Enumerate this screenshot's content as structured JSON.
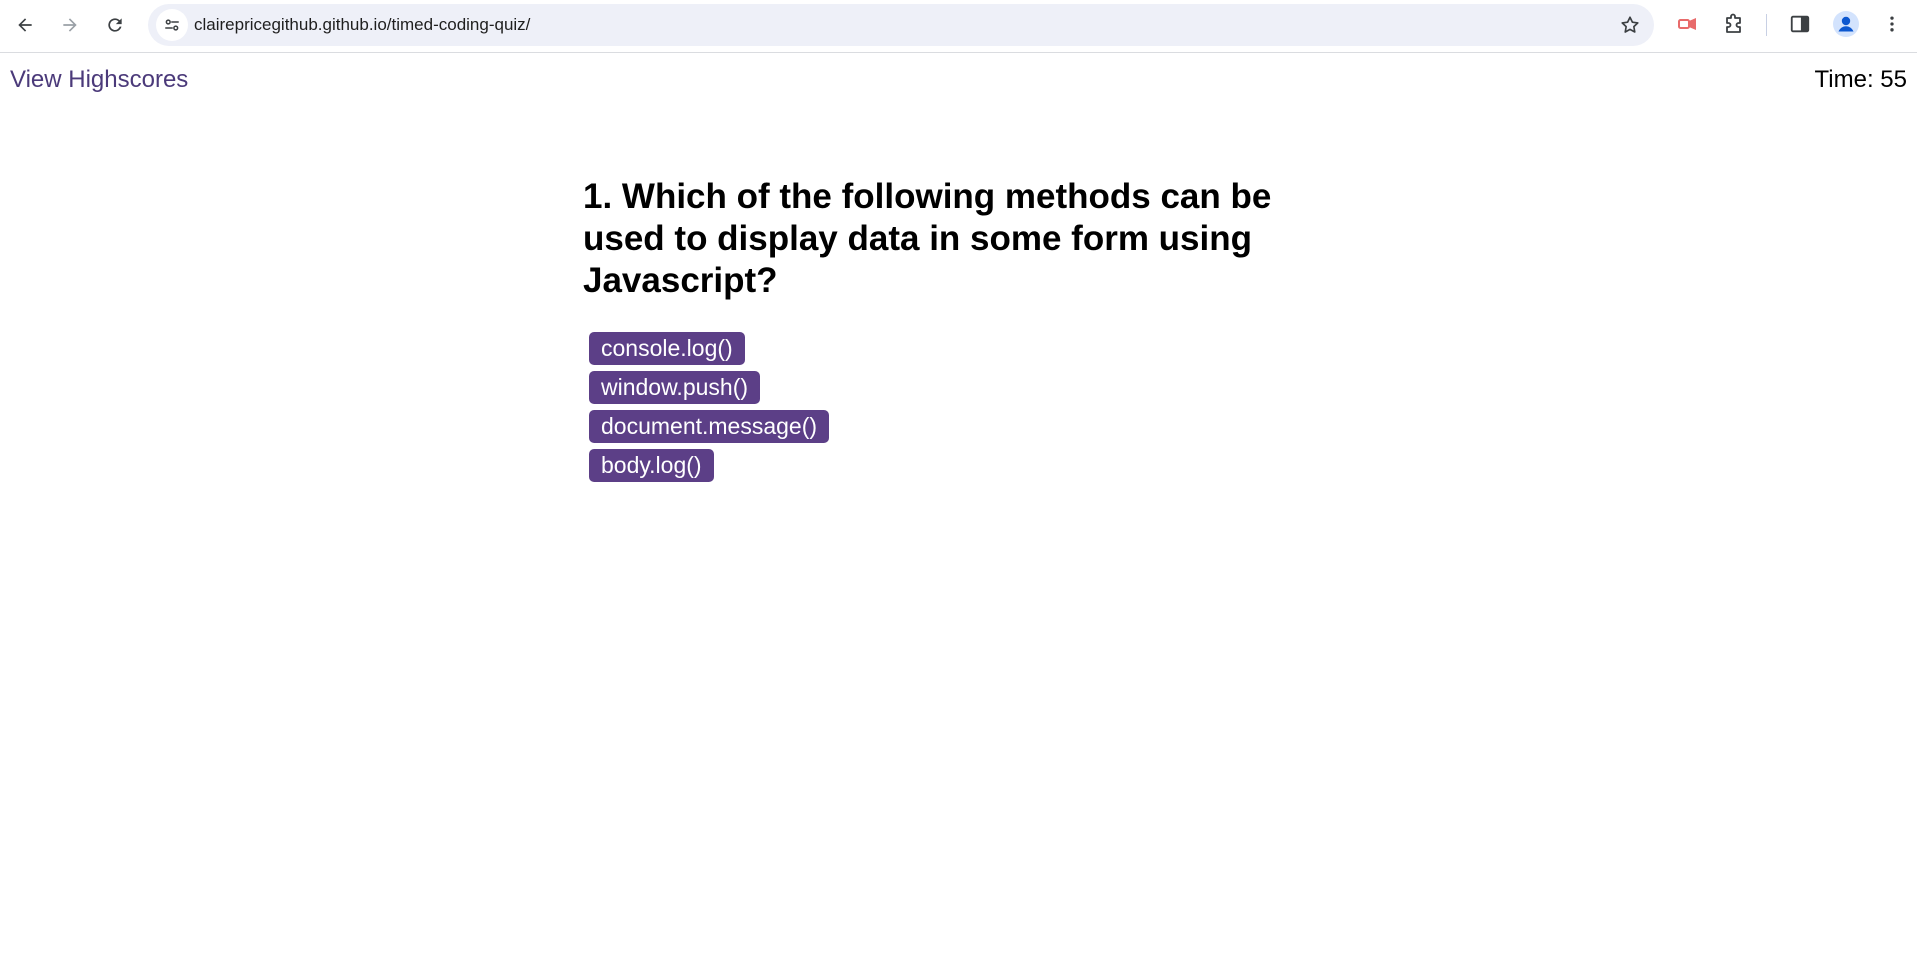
{
  "browser": {
    "url": "clairepricegithub.github.io/timed-coding-quiz/",
    "icons": {
      "back": "arrow-left-icon",
      "forward": "arrow-right-icon",
      "reload": "reload-icon",
      "site_info": "tune-icon",
      "bookmark": "star-icon",
      "extension_red": "extension-red-icon",
      "extensions": "puzzle-icon",
      "side_panel": "side-panel-icon",
      "profile": "profile-avatar-icon",
      "menu": "kebab-menu-icon"
    }
  },
  "header": {
    "highscores_link": "View Highscores",
    "timer": "Time: 55"
  },
  "quiz": {
    "question": "1. Which of the following methods can be used to display data in some form using Javascript?",
    "answers": [
      "console.log()",
      "window.push()",
      "document.message()",
      "body.log()"
    ]
  },
  "colors": {
    "accent": "#5c3f87",
    "link": "#4b3a7a"
  }
}
